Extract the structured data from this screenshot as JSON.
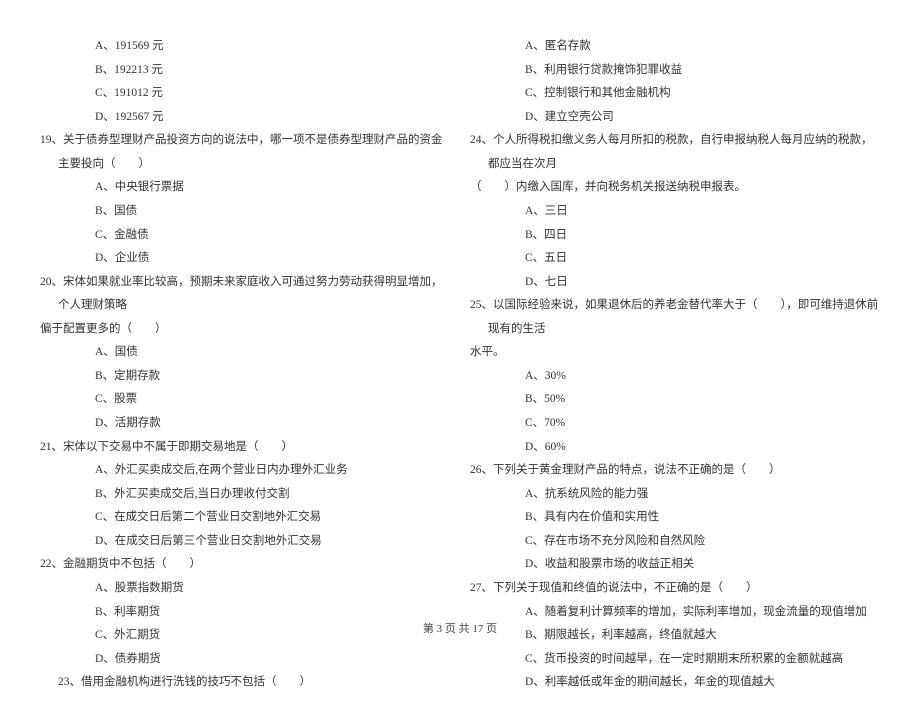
{
  "left": {
    "opts_top": [
      "A、191569 元",
      "B、192213 元",
      "C、191012 元",
      "D、192567 元"
    ],
    "q19": "19、关于债券型理财产品投资方向的说法中，哪一项不是债券型理财产品的资金主要投向（　　）",
    "q19_opts": [
      "A、中央银行票据",
      "B、国债",
      "C、金融债",
      "D、企业债"
    ],
    "q20_l1": "20、宋体如果就业率比较高，预期未来家庭收入可通过努力劳动获得明显增加，个人理财策略",
    "q20_l2": "偏于配置更多的（　　）",
    "q20_opts": [
      "A、国债",
      "B、定期存款",
      "C、股票",
      "D、活期存款"
    ],
    "q21": "21、宋体以下交易中不属于即期交易地是（　　）",
    "q21_opts": [
      "A、外汇买卖成交后,在两个营业日内办理外汇业务",
      "B、外汇买卖成交后,当日办理收付交割",
      "C、在成交日后第二个营业日交割地外汇交易",
      "D、在成交日后第三个营业日交割地外汇交易"
    ],
    "q22": "22、金融期货中不包括（　　）",
    "q22_opts": [
      "A、股票指数期货",
      "B、利率期货",
      "C、外汇期货",
      "D、债券期货"
    ],
    "q23": "23、借用金融机构进行洗钱的技巧不包括（　　）"
  },
  "right": {
    "q23_opts": [
      "A、匿名存款",
      "B、利用银行贷款掩饰犯罪收益",
      "C、控制银行和其他金融机构",
      "D、建立空壳公司"
    ],
    "q24_l1": "24、个人所得税扣缴义务人每月所扣的税款，自行申报纳税人每月应纳的税款，都应当在次月",
    "q24_l2": "（　　）内缴入国库，并向税务机关报送纳税申报表。",
    "q24_opts": [
      "A、三日",
      "B、四日",
      "C、五日",
      "D、七日"
    ],
    "q25_l1": "25、以国际经验来说，如果退休后的养老金替代率大于（　　），即可维持退休前现有的生活",
    "q25_l2": "水平。",
    "q25_opts": [
      "A、30%",
      "B、50%",
      "C、70%",
      "D、60%"
    ],
    "q26": "26、下列关于黄金理财产品的特点，说法不正确的是（　　）",
    "q26_opts": [
      "A、抗系统风险的能力强",
      "B、具有内在价值和实用性",
      "C、存在市场不充分风险和自然风险",
      "D、收益和股票市场的收益正相关"
    ],
    "q27": "27、下列关于现值和终值的说法中，不正确的是（　　）",
    "q27_opts": [
      "A、随着复利计算频率的增加，实际利率增加，现金流量的现值增加",
      "B、期限越长，利率越高，终值就越大",
      "C、货币投资的时间越早，在一定时期期末所积累的金额就越高",
      "D、利率越低或年金的期间越长，年金的现值越大"
    ]
  },
  "footer": "第 3 页 共 17 页"
}
